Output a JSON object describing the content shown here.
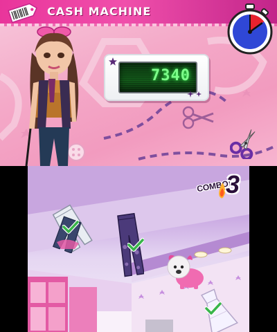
{
  "game": {
    "title": "CASH MACHINE",
    "cash_display": "7340",
    "timer_fraction_remaining": 0.85,
    "combo_label": "COMBO!",
    "combo_count": "3"
  },
  "icons": {
    "title_icon": "price-tag-icon",
    "timer_icon": "stopwatch-icon",
    "scissors_icon": "scissors-icon",
    "check_icon": "checkmark-icon"
  },
  "colors": {
    "title_bar": "#e9359b",
    "screen_green": "#7dff8a",
    "timer_red": "#e8222e",
    "timer_blue": "#2f47d6",
    "check_green": "#39b54a"
  },
  "falling_items": [
    "jeans",
    "jeans",
    "jeans",
    "plush-dog",
    "dress"
  ]
}
